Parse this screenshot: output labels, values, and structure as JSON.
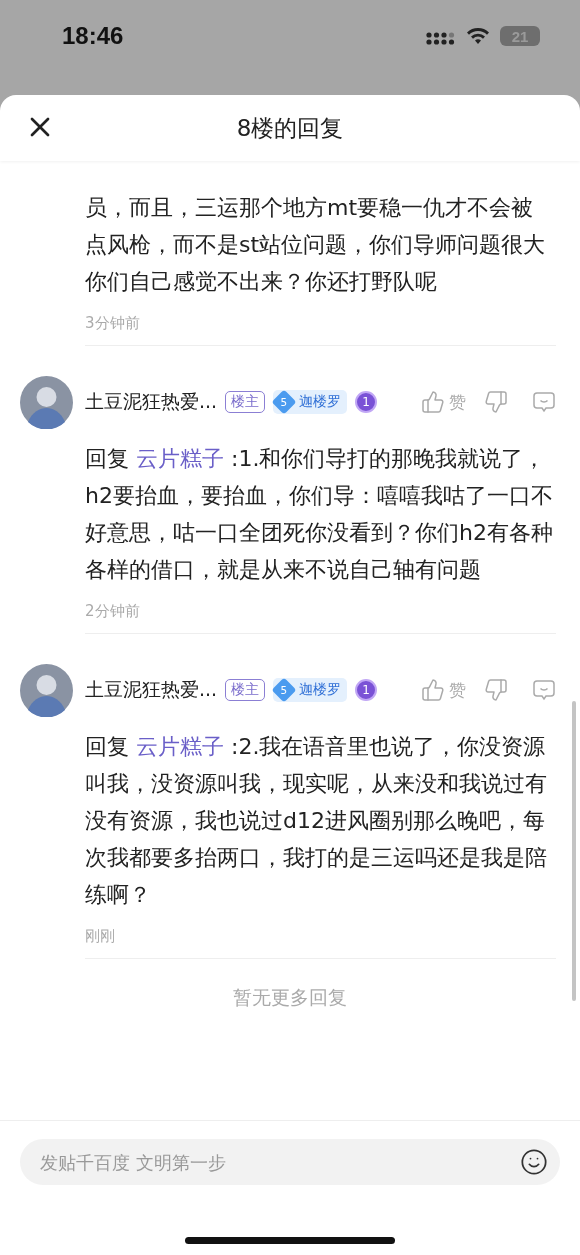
{
  "status_bar": {
    "time": "18:46",
    "battery": "21"
  },
  "sheet": {
    "title": "8楼的回复"
  },
  "comments": [
    {
      "kind": "partial",
      "body": "员，而且，三运那个地方mt要稳一仇才不会被点风枪，而不是st站位问题，你们导师问题很大你们自己感觉不出来？你还打野队呢",
      "time": "3分钟前"
    },
    {
      "kind": "reply",
      "author": "土豆泥狂热爱...",
      "owner_badge": "楼主",
      "level": "5",
      "level_name": "迦楼罗",
      "medal": "1",
      "like_label": "赞",
      "reply_prefix": "回复",
      "reply_to": "云片糕子",
      "body": ":1.和你们导打的那晚我就说了，h2要抬血，要抬血，你们导：嘻嘻我咕了一口不好意思，咕一口全团死你没看到？你们h2有各种各样的借口，就是从来不说自己轴有问题",
      "time": "2分钟前"
    },
    {
      "kind": "reply",
      "author": "土豆泥狂热爱...",
      "owner_badge": "楼主",
      "level": "5",
      "level_name": "迦楼罗",
      "medal": "1",
      "like_label": "赞",
      "reply_prefix": "回复",
      "reply_to": "云片糕子",
      "body": ":2.我在语音里也说了，你没资源叫我，没资源叫我，现实呢，从来没和我说过有没有资源，我也说过d12进风圈别那么晚吧，每次我都要多抬两口，我打的是三运吗还是我是陪练啊？",
      "time": "刚刚"
    }
  ],
  "end_note": "暂无更多回复",
  "composer": {
    "placeholder": "发贴千百度 文明第一步"
  }
}
